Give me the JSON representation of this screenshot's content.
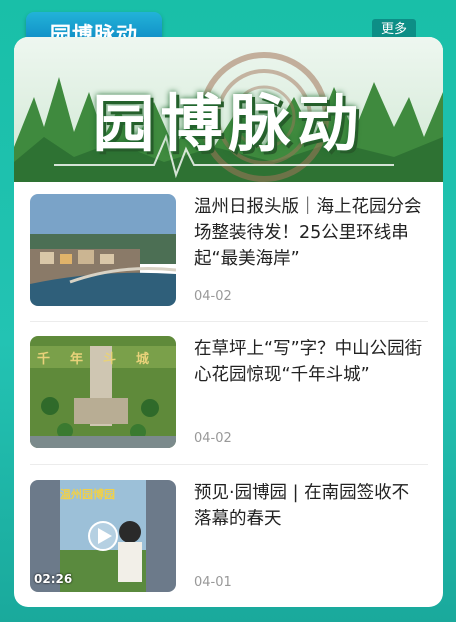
{
  "header": {
    "tab_label": "园博脉动",
    "more_label": "更多"
  },
  "banner": {
    "title": "园博脉动"
  },
  "news": [
    {
      "title": "温州日报头版｜海上花园分会场整装待发！25公里环线串起“最美海岸”",
      "date": "04-02"
    },
    {
      "title": "在草坪上“写”字？中山公园街心花园惊现“千年斗城”",
      "date": "04-02",
      "thumb_text": "千年斗城"
    },
    {
      "title": "预见·园博园 | 在南园签收不落幕的春天",
      "date": "04-01",
      "video_duration": "02:26",
      "thumb_text": "温州园博园"
    }
  ],
  "colors": {
    "accent": "#0d8e86",
    "background": "#1fbfae"
  }
}
